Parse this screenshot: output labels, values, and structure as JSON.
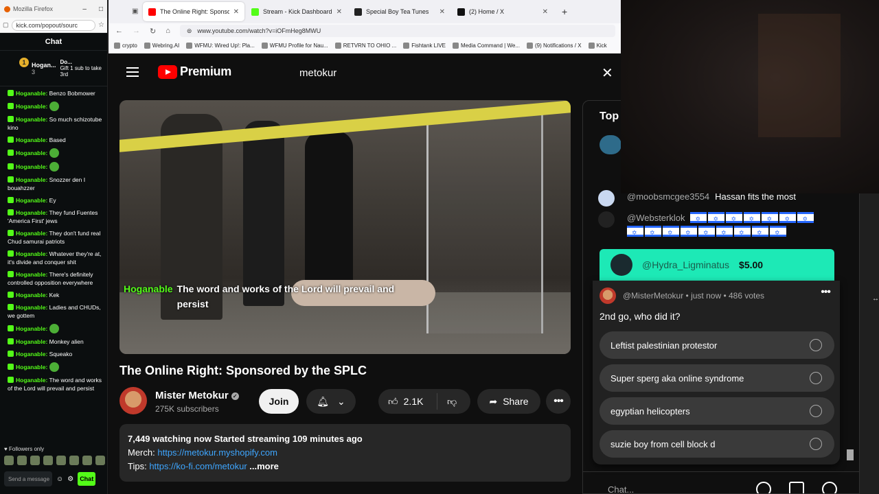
{
  "kick": {
    "window_title": "Mozilla Firefox",
    "url": "kick.com/popout/sourc",
    "chat_title": "Chat",
    "pinned": {
      "gifter_name": "Hogan...",
      "gifter_count": "3",
      "target_name": "Do...",
      "target_text": "Gift 1 sub to take 3rd"
    },
    "messages": [
      {
        "user": "Hoganable:",
        "text": "Benzo Bobmower",
        "emote": false
      },
      {
        "user": "Hoganable:",
        "text": "",
        "emote": true
      },
      {
        "user": "Hoganable:",
        "text": "So much schizotube kino",
        "emote": false
      },
      {
        "user": "Hoganable:",
        "text": "Based",
        "emote": false
      },
      {
        "user": "Hoganable:",
        "text": "",
        "emote": true
      },
      {
        "user": "Hoganable:",
        "text": "",
        "emote": true
      },
      {
        "user": "Hoganable:",
        "text": "Snozzer den I bouahzzer",
        "emote": false
      },
      {
        "user": "Hoganable:",
        "text": "Ey",
        "emote": false
      },
      {
        "user": "Hoganable:",
        "text": "They fund Fuentes 'America First' jews",
        "emote": false
      },
      {
        "user": "Hoganable:",
        "text": "They don't fund real Chud samurai patriots",
        "emote": false
      },
      {
        "user": "Hoganable:",
        "text": "Whatever they're at, it's divide and conquer shit",
        "emote": false
      },
      {
        "user": "Hoganable:",
        "text": "There's definitely controlled opposition everywhere",
        "emote": false
      },
      {
        "user": "Hoganable:",
        "text": "Kek",
        "emote": false
      },
      {
        "user": "Hoganable:",
        "text": "Ladies and CHUDs, we gottem",
        "emote": false
      },
      {
        "user": "Hoganable:",
        "text": "",
        "emote": true
      },
      {
        "user": "Hoganable:",
        "text": "Monkey alien",
        "emote": false
      },
      {
        "user": "Hoganable:",
        "text": "Squeako",
        "emote": false
      },
      {
        "user": "Hoganable:",
        "text": "",
        "emote": true
      },
      {
        "user": "Hoganable:",
        "text": "The word and works of the Lord will prevail and persist",
        "emote": false
      }
    ],
    "followers_only": "Followers only",
    "send_placeholder": "Send a message",
    "chat_button": "Chat"
  },
  "browser": {
    "tabs": [
      {
        "title": "The Online Right: Sponsore",
        "active": true,
        "color": "#ff0000"
      },
      {
        "title": "Stream - Kick Dashboard",
        "active": false,
        "color": "#53fc18"
      },
      {
        "title": "Special Boy Tea Tunes",
        "active": false,
        "color": "#222222"
      },
      {
        "title": "(2) Home / X",
        "active": false,
        "color": "#111111"
      }
    ],
    "url": "www.youtube.com/watch?v=iOFmHeg8MWU",
    "bookmarks": [
      "crypto",
      "Webring.AI",
      "WFMU: Wired Up!: Pla...",
      "WFMU Profile for Nau...",
      "RETVRN TO OHIO ...",
      "Fishtank LIVE",
      "Media Command | We...",
      "(9) Notifications / X",
      "Kick"
    ]
  },
  "youtube": {
    "logo_text": "Premium",
    "search_value": "metokur",
    "overlay_caption": {
      "user": "Hoganable",
      "text": "The word and works of the Lord will prevail and persist"
    },
    "video_title": "The Online Right: Sponsored by the SPLC",
    "channel_name": "Mister Metokur",
    "subscribers": "275K subscribers",
    "join_label": "Join",
    "likes": "2.1K",
    "share_label": "Share",
    "description": {
      "stats": "7,449 watching now  Started streaming 109 minutes ago",
      "merch_label": "Merch:",
      "merch_link": "https://metokur.myshopify.com",
      "tips_label": "Tips:",
      "tips_link": "https://ko-fi.com/metokur",
      "more": "...more"
    }
  },
  "live_chat": {
    "header": "Top c",
    "messages": [
      {
        "author": "@moobsmcgee3554",
        "text": "Hassan fits the most"
      },
      {
        "author": "@Websterklok",
        "text": ""
      }
    ],
    "superchat": {
      "author": "@Hydra_Ligminatus",
      "amount": "$5.00"
    },
    "poll": {
      "author": "@MisterMetokur",
      "meta": "• just now • 486 votes",
      "question": "2nd go, who did it?",
      "options": [
        "Leftist palestinian protestor",
        "Super sperg aka online syndrome",
        "egyptian helicopters",
        "suzie boy from cell block d"
      ]
    },
    "input_placeholder": "Chat..."
  }
}
